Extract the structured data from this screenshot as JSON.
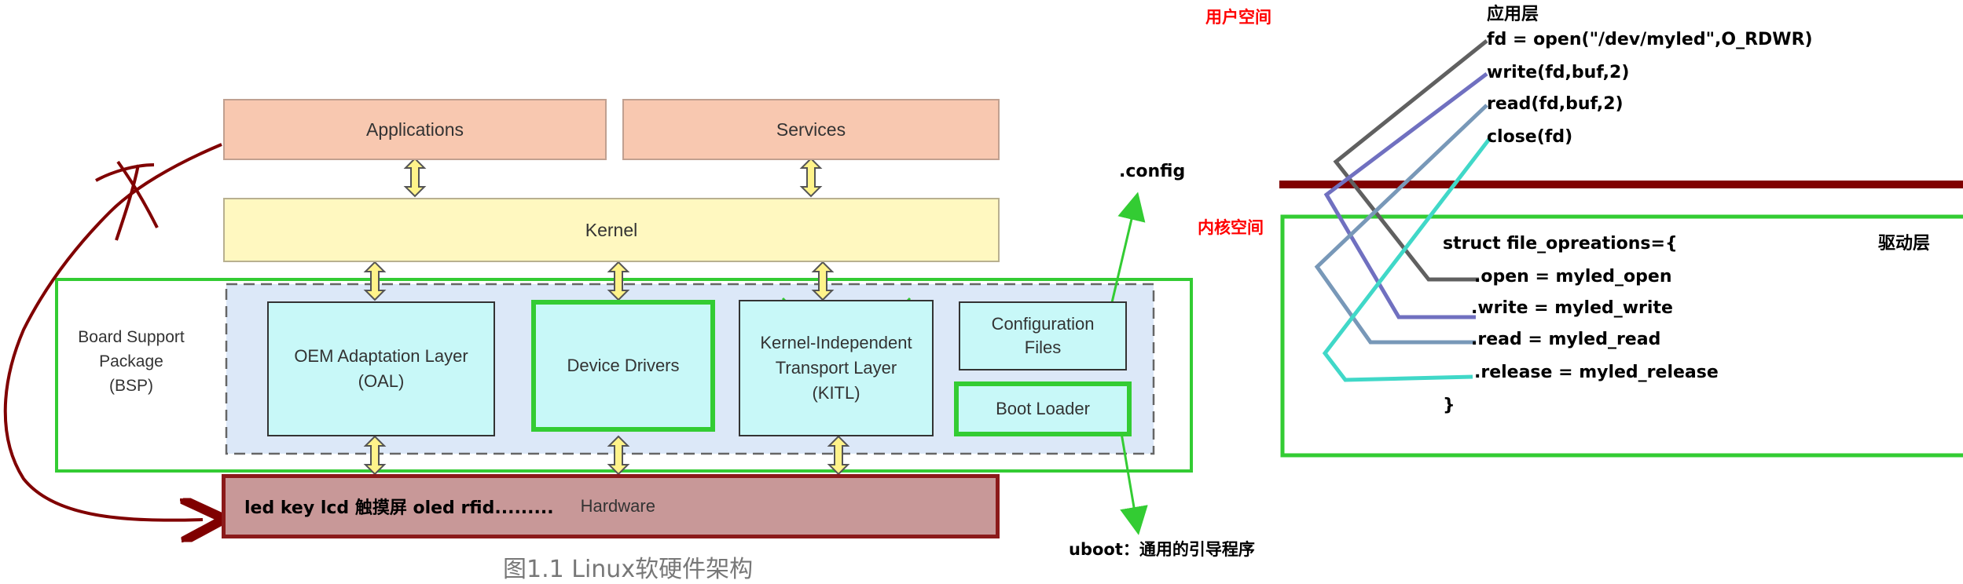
{
  "diagram": {
    "applications": "Applications",
    "services": "Services",
    "kernel": "Kernel",
    "bsp_label": [
      "Board Support",
      "Package",
      "(BSP)"
    ],
    "oal": [
      "OEM Adaptation Layer",
      "(OAL)"
    ],
    "device_drivers": "Device Drivers",
    "kitl": [
      "Kernel-Independent",
      "Transport Layer",
      "(KITL)"
    ],
    "config_files": [
      "Configuration",
      "Files"
    ],
    "boot_loader": "Boot Loader",
    "hardware_devices": "led key lcd 触摸屏 oled rfid.........",
    "hardware": "Hardware",
    "caption": "图1.1 Linux软硬件架构",
    "config_note": ".config",
    "uboot_note": "uboot：通用的引导程序"
  },
  "right": {
    "user_space": "用户空间",
    "kernel_space": "内核空间",
    "app_layer": "应用层",
    "driver_layer": "驱动层",
    "app_calls": [
      "fd = open(\"/dev/myled\",O_RDWR)",
      "write(fd,buf,2)",
      "read(fd,buf,2)",
      "close(fd)"
    ],
    "struct_header": "struct file_opreations={",
    "struct_members": [
      ".open = myled_open",
      ".write = myled_write",
      ".read = myled_read",
      ".release = myled_release"
    ],
    "struct_close": "}"
  },
  "colors": {
    "app_fill": "#f8c8b0",
    "kernel_fill": "#fff8c0",
    "bsp_fill": "#dce8f8",
    "module_fill": "#c8f8f8",
    "hardware_fill": "#c89898",
    "hardware_border": "#8b1a1a",
    "green": "#33cc33",
    "dark_red": "#800000",
    "line_gray": "#606060",
    "line_purple": "#7070c0",
    "line_steel": "#7898b8",
    "line_cyan": "#40d8c8"
  }
}
